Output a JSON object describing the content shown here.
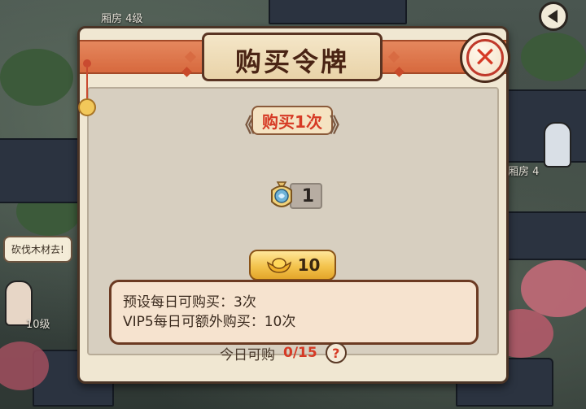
{
  "scene": {
    "building_label_top": "厢房 4级",
    "building_label_right": "厢房 4",
    "level_label_left": "10级",
    "speech_bubble": "砍伐木材去!"
  },
  "dialog": {
    "title": "购买令牌",
    "purchase_count_label": "购买1次",
    "item": {
      "icon": "token-icon",
      "quantity": "1"
    },
    "price_button": {
      "icon": "gold-ingot-icon",
      "price": "10"
    },
    "info_lines": [
      "预设每日可购买：3次",
      "VIP5每日可额外购买：10次"
    ],
    "today": {
      "label": "今日可购",
      "value": "0/15"
    },
    "help_symbol": "?"
  },
  "colors": {
    "title_band": "#d7693e",
    "accent_red": "#d63a25",
    "gold": "#f3c34d",
    "dialog_bg": "#f0e7d2"
  }
}
